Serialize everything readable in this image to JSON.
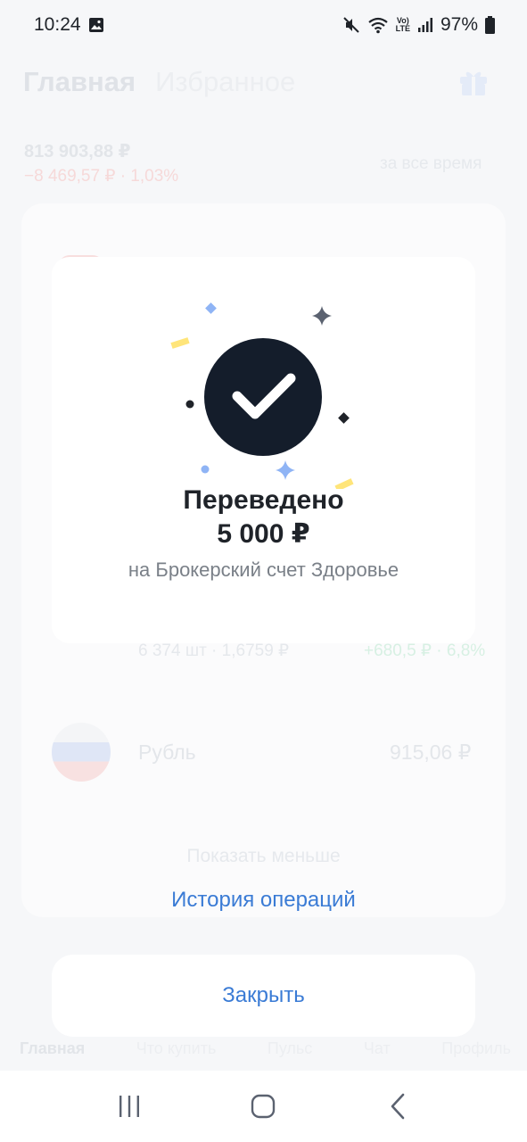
{
  "status_bar": {
    "time": "10:24",
    "volte_top": "Vo)",
    "volte_bottom": "LTE",
    "battery": "97%"
  },
  "background": {
    "tabs": [
      "Главная",
      "Избранное"
    ],
    "total": "813 903,88 ₽",
    "change": "−8 469,57 ₽ · 1,03%",
    "period": "за все время",
    "row_sub": "6 374 шт · 1,6759 ₽",
    "row_gain": "+680,5 ₽ · 6,8%",
    "ruble_name": "Рубль",
    "ruble_value": "915,06 ₽",
    "show_less": "Показать меньше",
    "nav": [
      "Главная",
      "Что купить",
      "Пульс",
      "Чат",
      "Профиль"
    ]
  },
  "dialog": {
    "title": "Переведено",
    "amount": "5 000 ₽",
    "subtitle": "на Брокерский счет Здоровье"
  },
  "history_link": "История операций",
  "close_button": "Закрыть",
  "colors": {
    "accent": "#3a7bd5",
    "check_circle": "#141d2b",
    "confetti_yellow": "#ffe57a",
    "confetti_blue": "#8fb4f5"
  },
  "icons": {
    "gallery": "image-icon",
    "mute": "mute-icon",
    "wifi": "wifi-icon",
    "signal": "signal-icon",
    "battery": "battery-icon",
    "success": "checkmark-icon",
    "recents": "recents-icon",
    "home": "home-icon",
    "back": "back-icon"
  }
}
